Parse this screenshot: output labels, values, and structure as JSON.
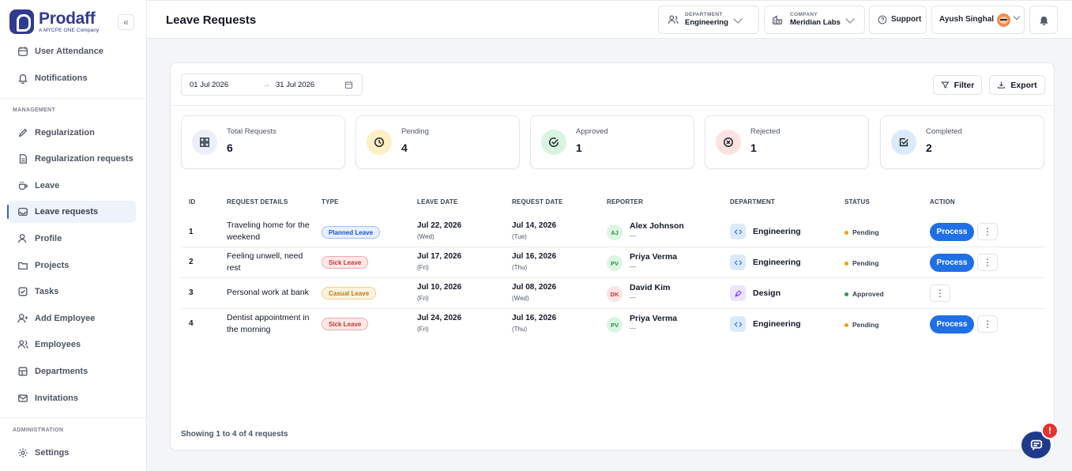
{
  "brand": {
    "name": "Prodaff",
    "tagline": "A MYCPE ONE Company"
  },
  "sidebar": {
    "collapse_label": "«",
    "items_top": [
      {
        "label": "User Attendance",
        "icon": "calendar-icon"
      },
      {
        "label": "Notifications",
        "icon": "bell-icon"
      }
    ],
    "section_management": "MANAGEMENT",
    "items_management": [
      {
        "label": "Regularization",
        "icon": "pencil-icon"
      },
      {
        "label": "Regularization requests",
        "icon": "document-icon"
      },
      {
        "label": "Leave",
        "icon": "coffee-icon"
      },
      {
        "label": "Leave requests",
        "icon": "inbox-icon",
        "active": true
      },
      {
        "label": "Profile",
        "icon": "user-icon"
      },
      {
        "label": "Projects",
        "icon": "folder-icon"
      },
      {
        "label": "Tasks",
        "icon": "checkbox-icon"
      },
      {
        "label": "Add Employee",
        "icon": "user-plus-icon"
      },
      {
        "label": "Employees",
        "icon": "users-icon"
      },
      {
        "label": "Departments",
        "icon": "building-icon"
      },
      {
        "label": "Invitations",
        "icon": "mail-icon"
      }
    ],
    "section_admin": "ADMINISTRATION",
    "items_admin": [
      {
        "label": "Settings",
        "icon": "gear-icon"
      }
    ]
  },
  "header": {
    "title": "Leave Requests",
    "department": {
      "label": "DEPARTMENT",
      "value": "Engineering"
    },
    "company": {
      "label": "COMPANY",
      "value": "Meridian Labs"
    },
    "support_label": "Support",
    "user_name": "Ayush Singhal"
  },
  "toolbar": {
    "date_from": "01 Jul 2026",
    "date_arrow": "→",
    "date_to": "31 Jul 2026",
    "filter_label": "Filter",
    "export_label": "Export"
  },
  "stats": [
    {
      "label": "Total Requests",
      "value": "6",
      "icon": "grid-icon",
      "bg": "#eceefb",
      "color": "#374151"
    },
    {
      "label": "Pending",
      "value": "4",
      "icon": "clock-icon",
      "bg": "#fdf0c4",
      "color": "#1f2329"
    },
    {
      "label": "Approved",
      "value": "1",
      "icon": "check-circle-icon",
      "bg": "#d9f5e1",
      "color": "#1f2329"
    },
    {
      "label": "Rejected",
      "value": "1",
      "icon": "x-circle-icon",
      "bg": "#fde2e2",
      "color": "#1f2329"
    },
    {
      "label": "Completed",
      "value": "2",
      "icon": "check-square-icon",
      "bg": "#dbeafb",
      "color": "#1f2329"
    }
  ],
  "table": {
    "headers": [
      "ID",
      "REQUEST DETAILS",
      "TYPE",
      "LEAVE DATE",
      "REQUEST DATE",
      "REPORTER",
      "DEPARTMENT",
      "STATUS",
      "ACTION"
    ],
    "rows": [
      {
        "id": "1",
        "details": "Traveling home for the weekend",
        "type": "Planned Leave",
        "type_class": "planned",
        "leave_date": "Jul 22, 2026",
        "leave_day": "(Wed)",
        "request_date": "Jul 14, 2026",
        "request_day": "(Tue)",
        "initials": "AJ",
        "reporter": "Alex Johnson",
        "reporter_sub": "—",
        "avatar_bg": "#dcf5e3",
        "avatar_color": "#2f8a4c",
        "department": "Engineering",
        "dept_kind": "code",
        "status": "Pending",
        "status_color": "#f59e0b",
        "process": "Process",
        "more": "⋮"
      },
      {
        "id": "2",
        "details": "Feeling unwell, need rest",
        "type": "Sick Leave",
        "type_class": "sick",
        "leave_date": "Jul 17, 2026",
        "leave_day": "(Fri)",
        "request_date": "Jul 16, 2026",
        "request_day": "(Thu)",
        "initials": "PV",
        "reporter": "Priya Verma",
        "reporter_sub": "—",
        "avatar_bg": "#dcf5e3",
        "avatar_color": "#2f8a4c",
        "department": "Engineering",
        "dept_kind": "code",
        "status": "Pending",
        "status_color": "#f59e0b",
        "process": "Process",
        "more": "⋮"
      },
      {
        "id": "3",
        "details": "Personal work at bank",
        "type": "Casual Leave",
        "type_class": "casual",
        "leave_date": "Jul 10, 2026",
        "leave_day": "(Fri)",
        "request_date": "Jul 08, 2026",
        "request_day": "(Wed)",
        "initials": "DK",
        "reporter": "David Kim",
        "reporter_sub": "—",
        "avatar_bg": "#fde2e6",
        "avatar_color": "#c0392b",
        "department": "Design",
        "dept_kind": "design",
        "status": "Approved",
        "status_color": "#16a34a",
        "process": "",
        "more": "⋮"
      },
      {
        "id": "4",
        "details": "Dentist appointment in the morning",
        "type": "Sick Leave",
        "type_class": "sick",
        "leave_date": "Jul 24, 2026",
        "leave_day": "(Fri)",
        "request_date": "Jul 16, 2026",
        "request_day": "(Thu)",
        "initials": "PV",
        "reporter": "Priya Verma",
        "reporter_sub": "—",
        "avatar_bg": "#dcf5e3",
        "avatar_color": "#2f8a4c",
        "department": "Engineering",
        "dept_kind": "code",
        "status": "Pending",
        "status_color": "#f59e0b",
        "process": "Process",
        "more": "⋮"
      }
    ],
    "footer": "Showing 1 to 4 of 4 requests"
  },
  "chat": {
    "badge": "!"
  }
}
